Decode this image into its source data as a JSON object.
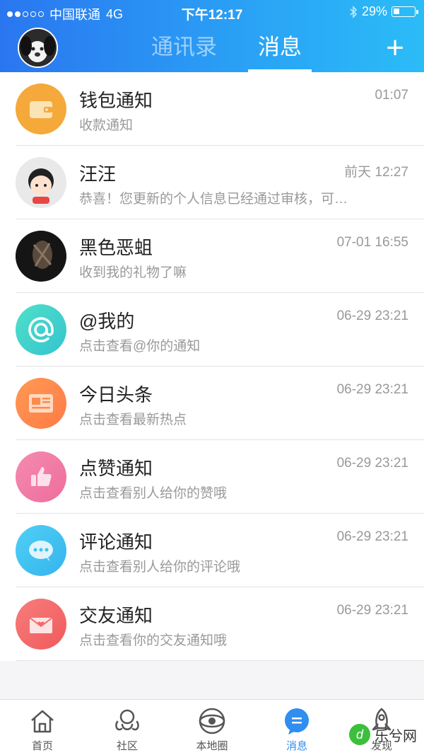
{
  "status_bar": {
    "carrier": "中国联通",
    "network": "4G",
    "time": "下午12:17",
    "battery": "29%",
    "battery_level": 0.29
  },
  "header": {
    "tabs": [
      {
        "label": "通讯录",
        "active": false
      },
      {
        "label": "消息",
        "active": true
      }
    ],
    "add_button": "+"
  },
  "messages": [
    {
      "name": "钱包通知",
      "preview": "收款通知",
      "time": "01:07",
      "icon": "wallet-icon",
      "color": "#f5a93a"
    },
    {
      "name": "汪汪",
      "preview": "恭喜！您更新的个人信息已经通过审核，可…",
      "time": "前天 12:27",
      "icon": "cartoon-avatar",
      "color": "#e6e6e6"
    },
    {
      "name": "黑色恶蛆",
      "preview": "收到我的礼物了嘛",
      "time": "07-01 16:55",
      "icon": "creature-avatar",
      "color": "#1b1b1b"
    },
    {
      "name": "@我的",
      "preview": "点击查看@你的通知",
      "time": "06-29 23:21",
      "icon": "at-icon",
      "color": "#3fd6c2"
    },
    {
      "name": "今日头条",
      "preview": "点击查看最新热点",
      "time": "06-29 23:21",
      "icon": "newspaper-icon",
      "color": "#ff8a4a"
    },
    {
      "name": "点赞通知",
      "preview": "点击查看别人给你的赞哦",
      "time": "06-29 23:21",
      "icon": "thumbs-up-icon",
      "color": "#f27aa6"
    },
    {
      "name": "评论通知",
      "preview": "点击查看别人给你的评论哦",
      "time": "06-29 23:21",
      "icon": "comment-icon",
      "color": "#3ec1f0"
    },
    {
      "name": "交友通知",
      "preview": "点击查看你的交友通知哦",
      "time": "06-29 23:21",
      "icon": "envelope-heart-icon",
      "color": "#f56a6a"
    }
  ],
  "nav": [
    {
      "label": "首页",
      "icon": "home-icon",
      "active": false
    },
    {
      "label": "社区",
      "icon": "community-icon",
      "active": false
    },
    {
      "label": "本地圈",
      "icon": "local-circle-icon",
      "active": false
    },
    {
      "label": "消息",
      "icon": "message-icon",
      "active": true
    },
    {
      "label": "发现",
      "icon": "rocket-icon",
      "active": false
    }
  ],
  "watermark": {
    "text": "乐兮网",
    "badge": "d"
  }
}
